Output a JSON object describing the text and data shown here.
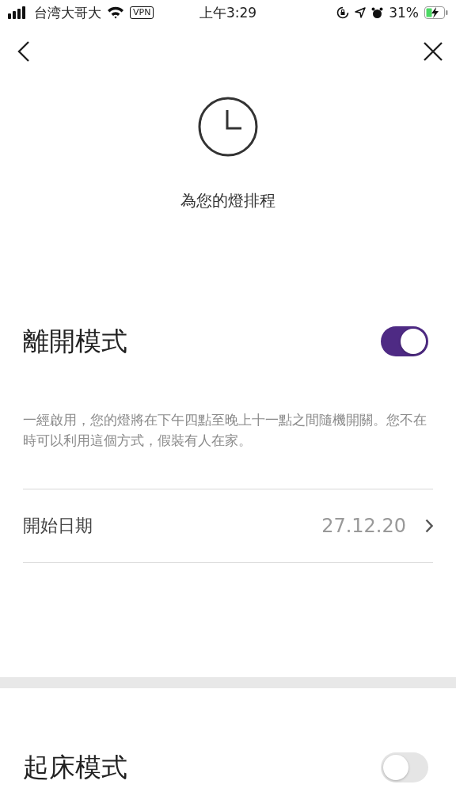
{
  "status_bar": {
    "carrier": "台湾大哥大",
    "vpn": "VPN",
    "time": "上午3:29",
    "battery": "31%"
  },
  "header": {
    "title": "為您的燈排程"
  },
  "modes": [
    {
      "title": "離開模式",
      "on": true,
      "description": "一經啟用，您的燈將在下午四點至晚上十一點之間隨機開關。您不在時可以利用這個方式，假裝有人在家。",
      "rows": [
        {
          "label": "開始日期",
          "value": "27.12.20"
        }
      ]
    },
    {
      "title": "起床模式",
      "on": false
    }
  ]
}
